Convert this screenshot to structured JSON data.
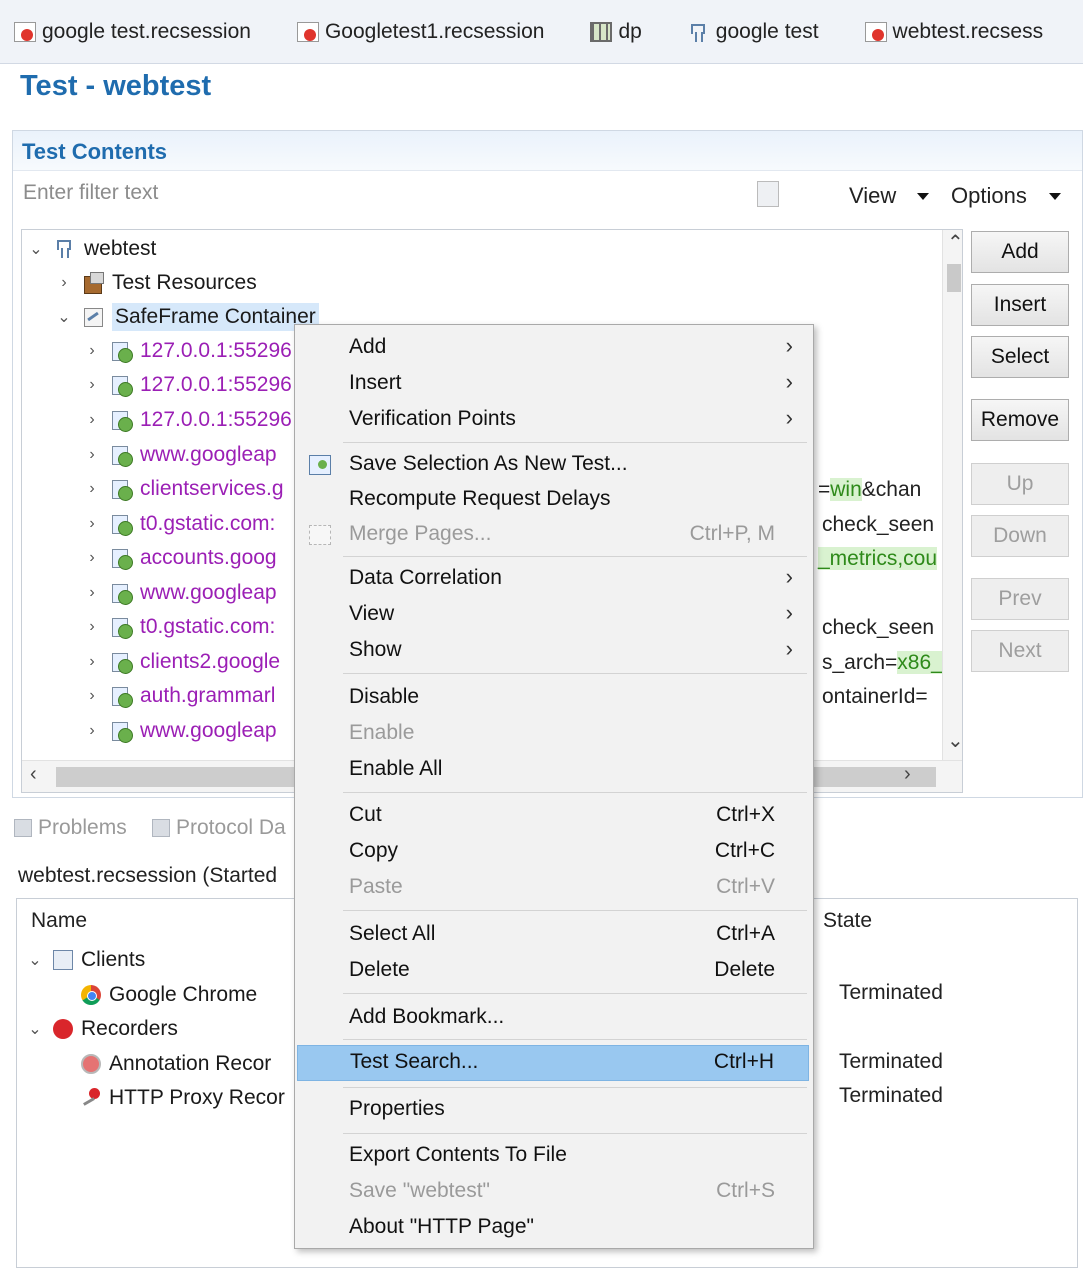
{
  "tabs": [
    {
      "label": "google test.recsession",
      "icon": "recording-session-icon"
    },
    {
      "label": "Googletest1.recsession",
      "icon": "recording-session-icon"
    },
    {
      "label": "dp",
      "icon": "datapool-icon"
    },
    {
      "label": "google test",
      "icon": "test-icon"
    },
    {
      "label": "webtest.recsess",
      "icon": "recording-session-icon"
    }
  ],
  "editor": {
    "title": "Test - webtest",
    "section_title": "Test Contents",
    "filter_placeholder": "Enter filter text",
    "view_label": "View",
    "options_label": "Options"
  },
  "tree": {
    "root": "webtest",
    "test_resources": "Test Resources",
    "container": "SafeFrame Container",
    "pages": [
      "127.0.0.1:55296",
      "127.0.0.1:55296",
      "127.0.0.1:55296",
      "www.googleap",
      "clientservices.g",
      "t0.gstatic.com:",
      "accounts.goog",
      "www.googleap",
      "t0.gstatic.com:",
      "clients2.google",
      "auth.grammarl",
      "www.googleap"
    ],
    "right_fragments": [
      {
        "plain_before": "=",
        "highlight": "win",
        "plain_after": "&chan"
      },
      {
        "plain_before": "check_seen",
        "highlight": "",
        "plain_after": ""
      },
      {
        "plain_before": "",
        "highlight": "_metrics,cou",
        "plain_after": ""
      },
      {
        "plain_before": "check_seen",
        "highlight": "",
        "plain_after": ""
      },
      {
        "plain_before": "s_arch=",
        "highlight": "x86_",
        "plain_after": ""
      },
      {
        "plain_before": "ontainerId=",
        "highlight": "",
        "plain_after": ""
      }
    ]
  },
  "side_buttons": {
    "add": "Add",
    "insert": "Insert",
    "select": "Select",
    "remove": "Remove",
    "up": "Up",
    "down": "Down",
    "prev": "Prev",
    "next": "Next"
  },
  "bottom": {
    "problems_tab": "Problems",
    "protocol_tab": "Protocol Da",
    "session_label": "webtest.recsession (Started",
    "col_name": "Name",
    "col_state": "State",
    "rows": [
      {
        "label": "Clients",
        "state": ""
      },
      {
        "label": "Google Chrome",
        "state": "Terminated"
      },
      {
        "label": "Recorders",
        "state": ""
      },
      {
        "label": "Annotation Recor",
        "state": "Terminated"
      },
      {
        "label": "HTTP Proxy Recor",
        "state": "Terminated"
      }
    ]
  },
  "context_menu": {
    "add": "Add",
    "insert": "Insert",
    "verification_points": "Verification Points",
    "save_selection": "Save Selection As New Test...",
    "recompute": "Recompute Request Delays",
    "merge_pages": "Merge Pages...",
    "merge_pages_key": "Ctrl+P, M",
    "data_correlation": "Data Correlation",
    "view": "View",
    "show": "Show",
    "disable": "Disable",
    "enable": "Enable",
    "enable_all": "Enable All",
    "cut": "Cut",
    "cut_key": "Ctrl+X",
    "copy": "Copy",
    "copy_key": "Ctrl+C",
    "paste": "Paste",
    "paste_key": "Ctrl+V",
    "select_all": "Select All",
    "select_all_key": "Ctrl+A",
    "delete": "Delete",
    "delete_key": "Delete",
    "add_bookmark": "Add Bookmark...",
    "test_search": "Test Search...",
    "test_search_key": "Ctrl+H",
    "properties": "Properties",
    "export": "Export Contents To File",
    "save": "Save \"webtest\"",
    "save_key": "Ctrl+S",
    "about": "About \"HTTP Page\""
  },
  "colors": {
    "title_blue": "#1f6cae",
    "page_purple": "#9b1fb5",
    "menu_highlight": "#99c8f0"
  }
}
